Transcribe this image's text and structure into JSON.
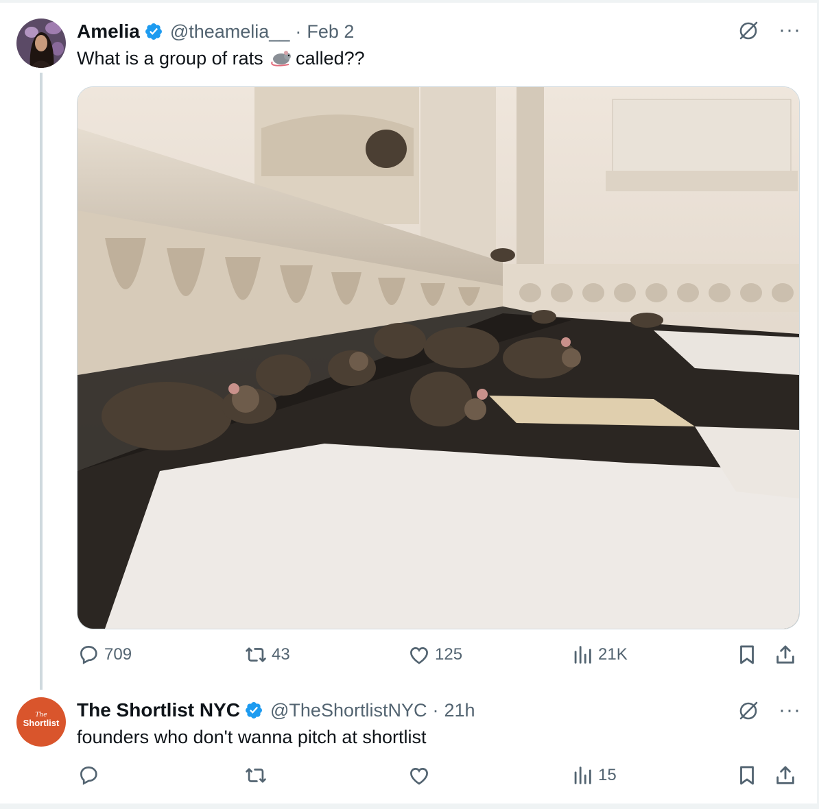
{
  "tweet1": {
    "author_name": "Amelia",
    "handle": "@theamelia__",
    "separator": "·",
    "time": "Feb 2",
    "text_before_emoji": "What is a group of rats ",
    "emoji": "rat-emoji",
    "text_after_emoji": "called??",
    "media": "photo of many rats on a temple marble floor",
    "replies": "709",
    "reposts": "43",
    "likes": "125",
    "views": "21K"
  },
  "tweet2": {
    "author_name": "The Shortlist NYC",
    "handle": "@TheShortlistNYC",
    "separator": "·",
    "time": "21h",
    "text": "founders who don't wanna pitch at shortlist",
    "avatar_text_small": "The",
    "avatar_text": "Shortlist",
    "views": "15"
  },
  "colors": {
    "secondary_text": "#536471",
    "verified_blue": "#1d9bf0",
    "shortlist_orange": "#d9552c",
    "divider": "#eff3f4"
  },
  "icons": [
    "verified-badge-icon",
    "grok-icon",
    "more-icon",
    "reply-icon",
    "repost-icon",
    "like-icon",
    "views-icon",
    "bookmark-icon",
    "share-icon"
  ]
}
